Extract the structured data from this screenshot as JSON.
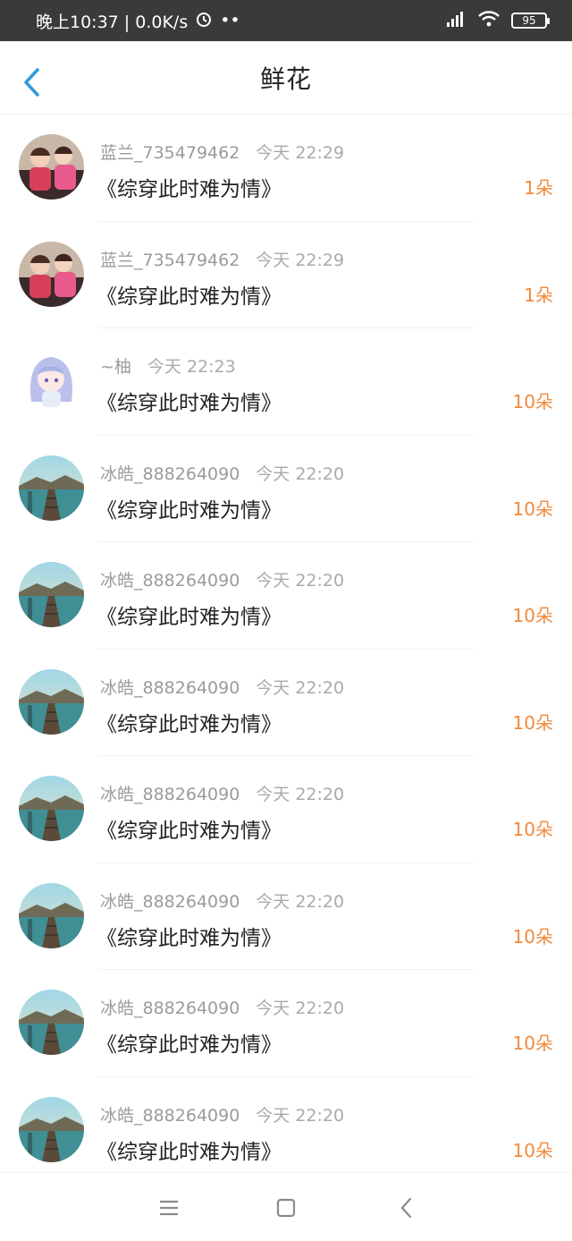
{
  "status_bar": {
    "time_speed": "晚上10:37 | 0.0K/s",
    "battery": "95",
    "icons": [
      "alarm-icon",
      "signal-icon",
      "wifi-icon",
      "battery-icon"
    ]
  },
  "header": {
    "title": "鲜花",
    "back_icon": "chevron-left-icon"
  },
  "colors": {
    "accent_blue": "#2d9cdb",
    "count_orange": "#f08a3c",
    "meta_gray": "#9b9b9b"
  },
  "rows": [
    {
      "user": "蓝兰_735479462",
      "time": "今天 22:29",
      "book": "《综穿此时难为情》",
      "count": "1朵",
      "avatar": "kids-avatar"
    },
    {
      "user": "蓝兰_735479462",
      "time": "今天 22:29",
      "book": "《综穿此时难为情》",
      "count": "1朵",
      "avatar": "kids-avatar"
    },
    {
      "user": "~柚",
      "time": "今天 22:23",
      "book": "《综穿此时难为情》",
      "count": "10朵",
      "avatar": "anime-avatar"
    },
    {
      "user": "冰皓_888264090",
      "time": "今天 22:20",
      "book": "《综穿此时难为情》",
      "count": "10朵",
      "avatar": "pier-avatar"
    },
    {
      "user": "冰皓_888264090",
      "time": "今天 22:20",
      "book": "《综穿此时难为情》",
      "count": "10朵",
      "avatar": "pier-avatar"
    },
    {
      "user": "冰皓_888264090",
      "time": "今天 22:20",
      "book": "《综穿此时难为情》",
      "count": "10朵",
      "avatar": "pier-avatar"
    },
    {
      "user": "冰皓_888264090",
      "time": "今天 22:20",
      "book": "《综穿此时难为情》",
      "count": "10朵",
      "avatar": "pier-avatar"
    },
    {
      "user": "冰皓_888264090",
      "time": "今天 22:20",
      "book": "《综穿此时难为情》",
      "count": "10朵",
      "avatar": "pier-avatar"
    },
    {
      "user": "冰皓_888264090",
      "time": "今天 22:20",
      "book": "《综穿此时难为情》",
      "count": "10朵",
      "avatar": "pier-avatar"
    },
    {
      "user": "冰皓_888264090",
      "time": "今天 22:20",
      "book": "《综穿此时难为情》",
      "count": "10朵",
      "avatar": "pier-avatar"
    }
  ],
  "nav_bar": {
    "icons": [
      "menu-icon",
      "home-icon",
      "back-icon"
    ]
  }
}
